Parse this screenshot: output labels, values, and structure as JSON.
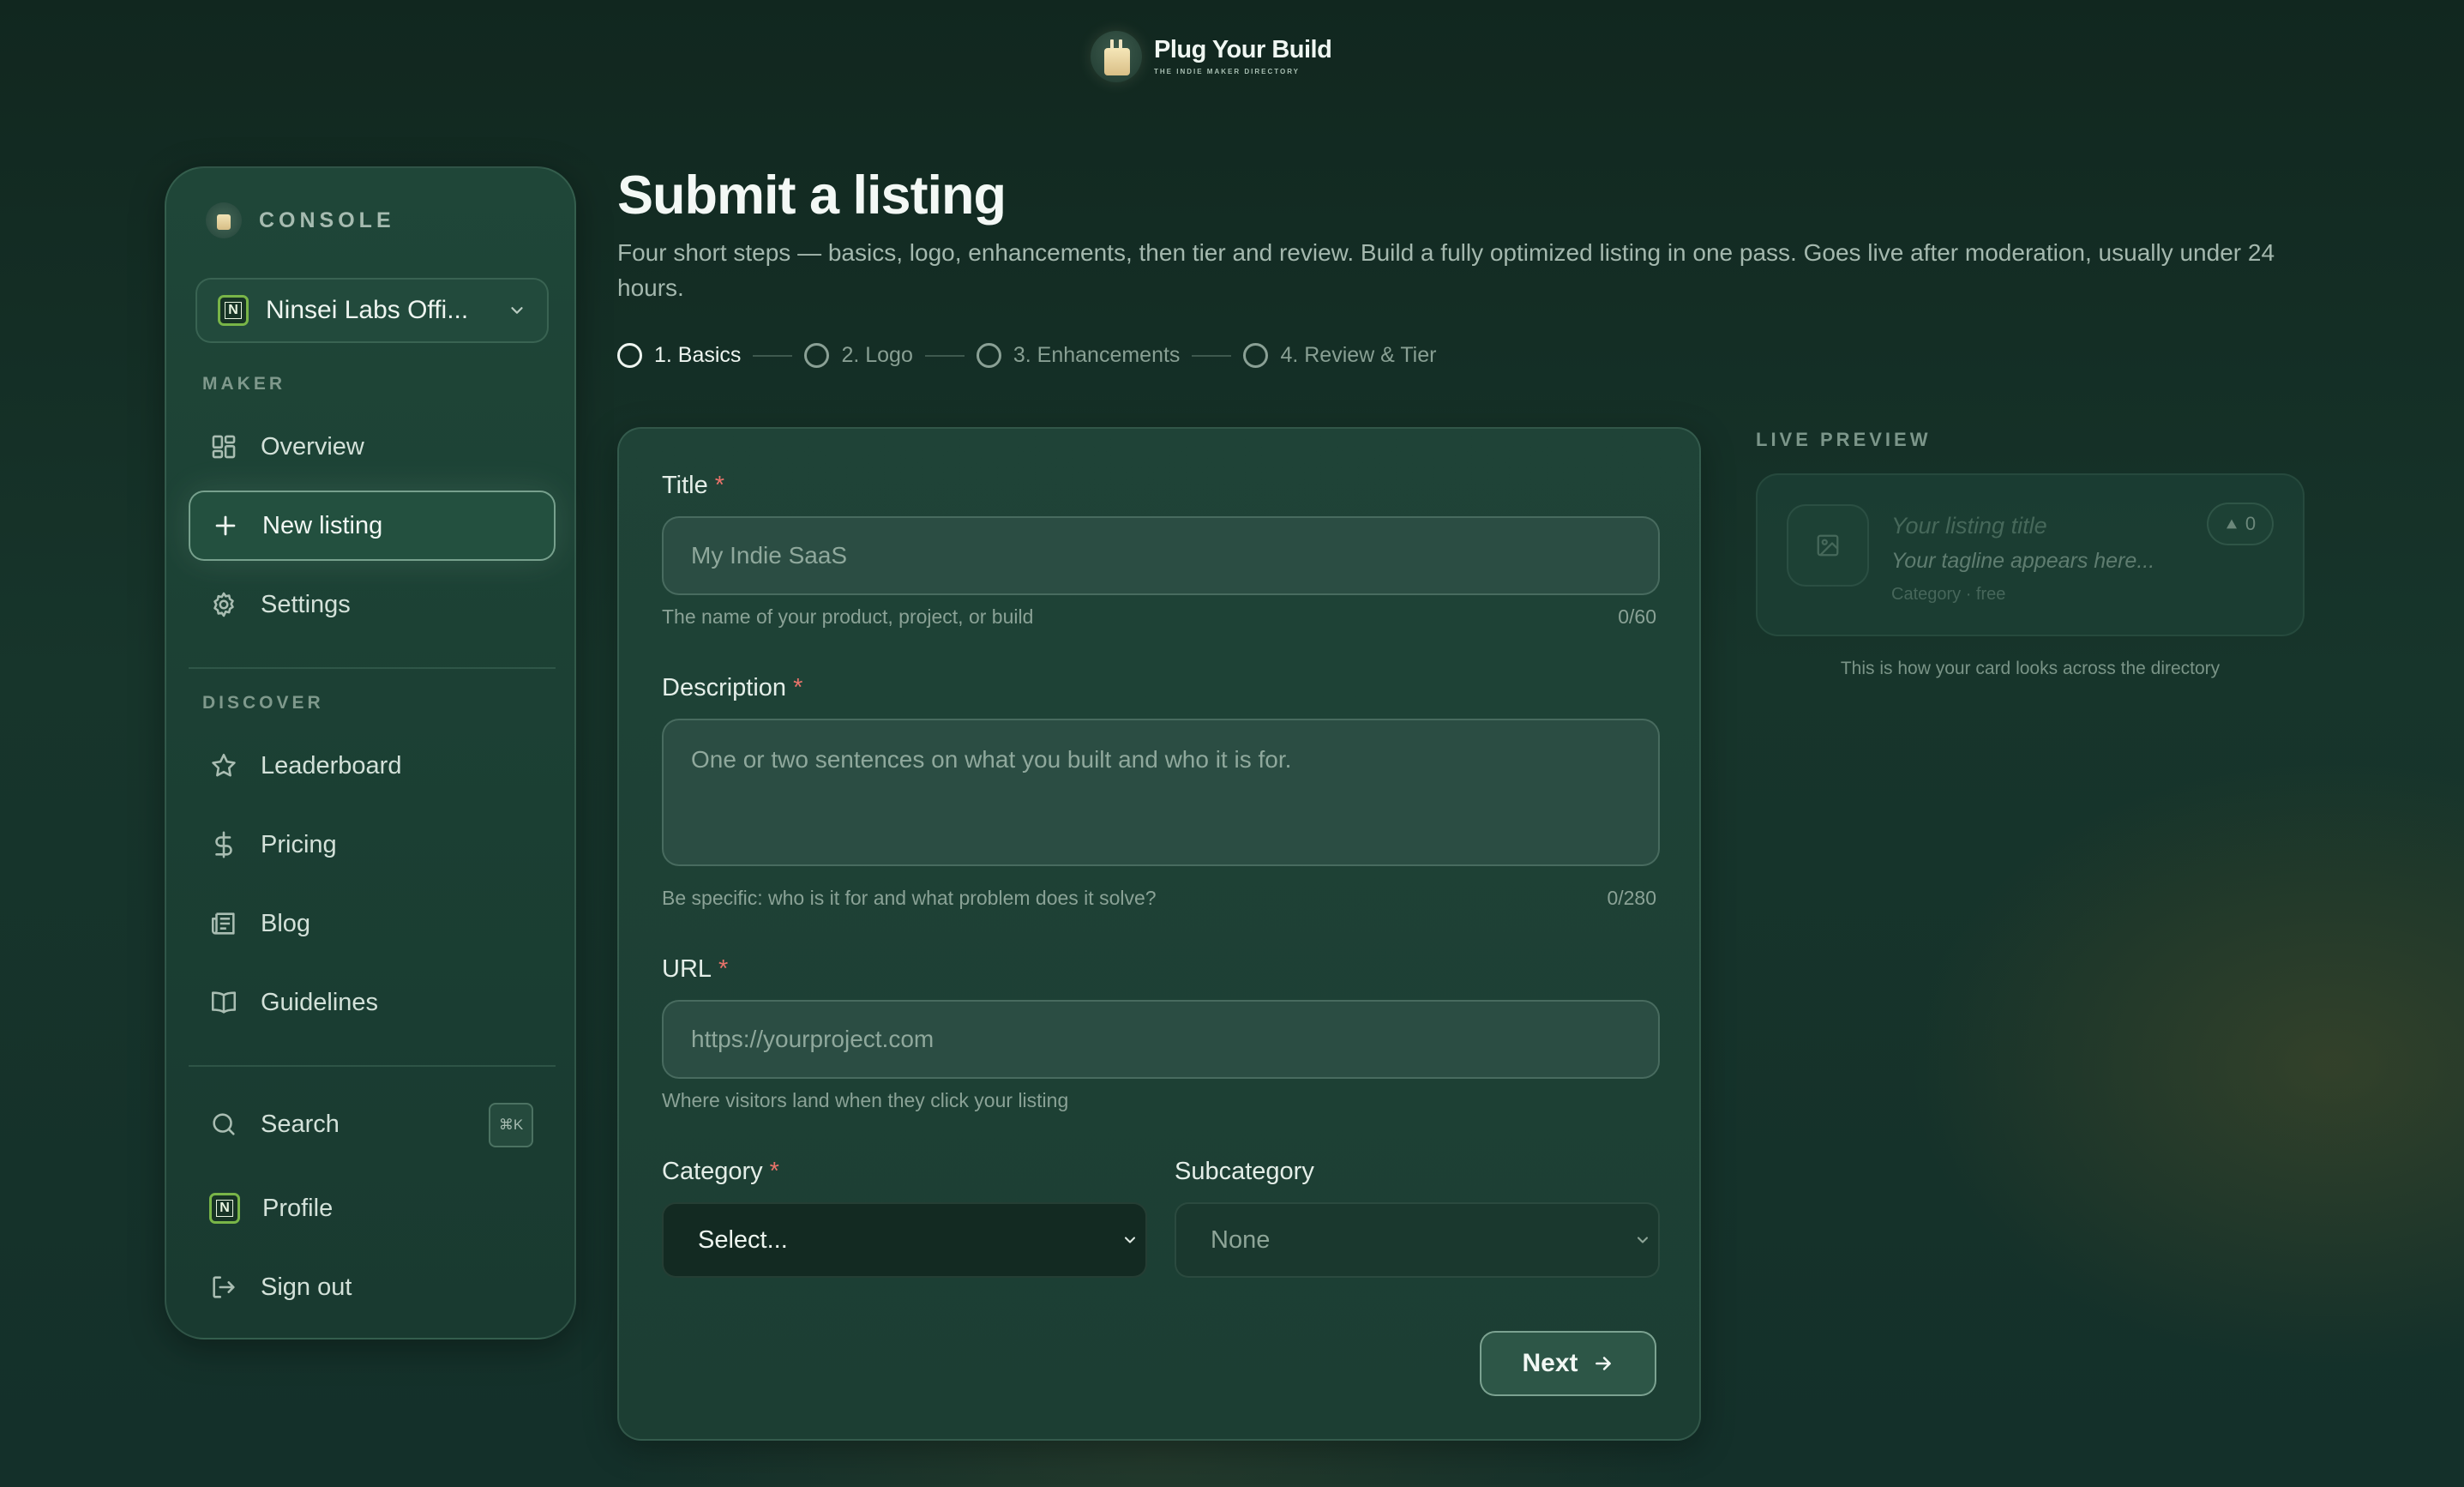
{
  "brand": {
    "name": "Plug Your Build",
    "tagline": "THE INDIE MAKER DIRECTORY"
  },
  "sidebar": {
    "console_label": "CONSOLE",
    "workspace": {
      "badge": "N",
      "name": "Ninsei Labs Offi..."
    },
    "maker_label": "MAKER",
    "maker_items": [
      {
        "label": "Overview",
        "icon": "grid-icon"
      },
      {
        "label": "New listing",
        "icon": "plus-icon",
        "active": true
      },
      {
        "label": "Settings",
        "icon": "gear-icon"
      }
    ],
    "discover_label": "DISCOVER",
    "discover_items": [
      {
        "label": "Leaderboard",
        "icon": "star-icon"
      },
      {
        "label": "Pricing",
        "icon": "dollar-icon"
      },
      {
        "label": "Blog",
        "icon": "newspaper-icon"
      },
      {
        "label": "Guidelines",
        "icon": "book-icon"
      }
    ],
    "search": {
      "label": "Search",
      "shortcut": "⌘K"
    },
    "profile": {
      "label": "Profile",
      "badge": "N"
    },
    "signout": {
      "label": "Sign out"
    }
  },
  "header": {
    "title": "Submit a listing",
    "subtitle": "Four short steps — basics, logo, enhancements, then tier and review. Build a fully optimized listing in one pass. Goes live after moderation, usually under 24 hours."
  },
  "steps": [
    {
      "label": "1. Basics",
      "active": true
    },
    {
      "label": "2. Logo",
      "active": false
    },
    {
      "label": "3. Enhancements",
      "active": false
    },
    {
      "label": "4. Review & Tier",
      "active": false
    }
  ],
  "form": {
    "title": {
      "label": "Title",
      "required": "*",
      "placeholder": "My Indie SaaS",
      "hint": "The name of your product, project, or build",
      "count": "0/60"
    },
    "description": {
      "label": "Description",
      "required": "*",
      "placeholder": "One or two sentences on what you built and who it is for.",
      "hint": "Be specific: who is it for and what problem does it solve?",
      "count": "0/280"
    },
    "url": {
      "label": "URL",
      "required": "*",
      "placeholder": "https://yourproject.com",
      "hint": "Where visitors land when they click your listing"
    },
    "category": {
      "label": "Category",
      "required": "*",
      "value": "Select..."
    },
    "subcategory": {
      "label": "Subcategory",
      "value": "None"
    },
    "next_label": "Next"
  },
  "preview": {
    "label": "LIVE PREVIEW",
    "title": "Your listing title",
    "tagline": "Your tagline appears here...",
    "meta": "Category · free",
    "votes": "0",
    "caption": "This is how your card looks across the directory"
  },
  "colors": {
    "accent_required": "#e8736a",
    "badge_border": "#79b548"
  }
}
